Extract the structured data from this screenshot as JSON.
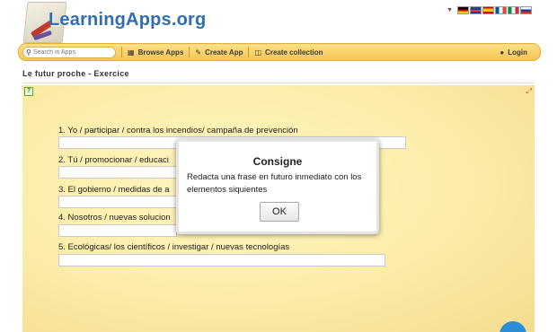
{
  "header": {
    "logo_text": "LearningApps.org",
    "language_flags": [
      "german-flag-icon",
      "english-flag-icon",
      "spanish-flag-icon",
      "french-flag-icon",
      "italian-flag-icon",
      "russian-flag-icon"
    ]
  },
  "nav": {
    "search_placeholder": "Search in Apps",
    "browse_label": "Browse Apps",
    "create_label": "Create App",
    "collection_label": "Create collection",
    "login_label": "Login"
  },
  "page": {
    "title": "Le futur proche - Exercice"
  },
  "exercise": {
    "questions": [
      {
        "text": "1. Yo / participar / contra los incendios/ campaña de prevención"
      },
      {
        "text": "2. Tú / promocionar / educaci"
      },
      {
        "text": "3. El gobierno / medidas de a"
      },
      {
        "text": "4. Nosotros / nuevas solucion"
      },
      {
        "text": "5. Ecológicas/ los científicos / investigar / nuevas tecnologías"
      }
    ]
  },
  "modal": {
    "title": "Consigne",
    "text": "Redacta una frase en futuro inmediato con los elementos siquientes",
    "ok_label": "OK"
  },
  "colors": {
    "nav_bar": "#f6c64f",
    "logo_text": "#2f6eb5",
    "exercise_bg": "#fbeca7"
  }
}
